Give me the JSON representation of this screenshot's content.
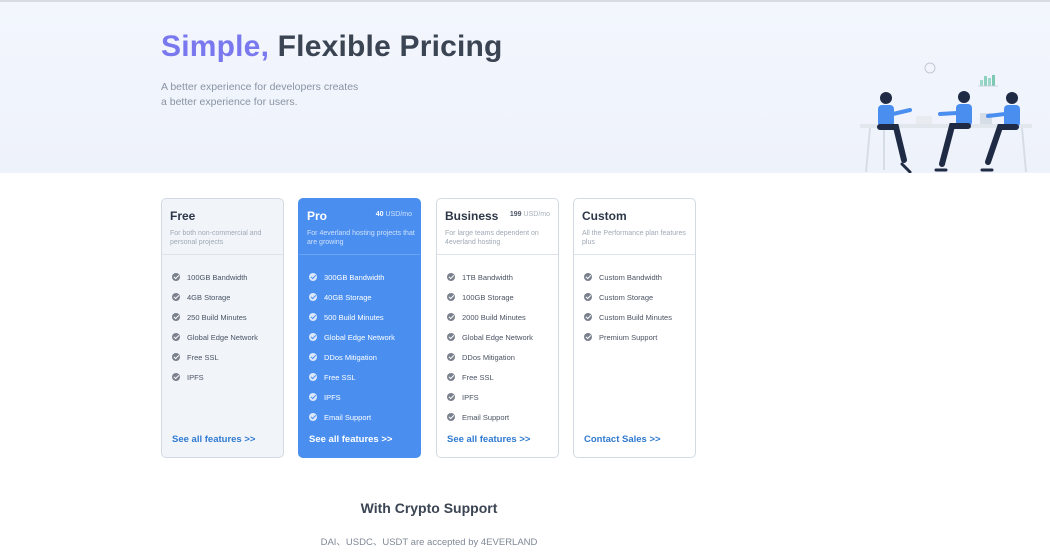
{
  "hero": {
    "title_accent": "Simple,",
    "title_rest": " Flexible Pricing",
    "subtitle_line1": "A better experience for developers creates",
    "subtitle_line2": "a better experience for users."
  },
  "plans": [
    {
      "name": "Free",
      "price": "",
      "price_unit": "",
      "description": "For both non-commercial and personal projects",
      "features": [
        "100GB Bandwidth",
        "4GB Storage",
        "250 Build Minutes",
        "Global Edge Network",
        "Free SSL",
        "IPFS"
      ],
      "link": "See all features >>"
    },
    {
      "name": "Pro",
      "price": "40",
      "price_unit": "USD/mo",
      "description": "For 4everland hosting projects that are growing",
      "features": [
        "300GB Bandwidth",
        "40GB Storage",
        "500 Build Minutes",
        "Global Edge Network",
        "DDos Mitigation",
        "Free SSL",
        "IPFS",
        "Email Support"
      ],
      "link": "See all features >>"
    },
    {
      "name": "Business",
      "price": "199",
      "price_unit": "USD/mo",
      "description": "For large teams dependent on 4everland hosting",
      "features": [
        "1TB Bandwidth",
        "100GB Storage",
        "2000 Build Minutes",
        "Global Edge Network",
        "DDos Mitigation",
        "Free SSL",
        "IPFS",
        "Email Support"
      ],
      "link": "See all features >>"
    },
    {
      "name": "Custom",
      "price": "",
      "price_unit": "",
      "description": "All the Performance plan features plus",
      "features": [
        "Custom Bandwidth",
        "Custom Storage",
        "Custom Build Minutes",
        "Premium Support"
      ],
      "link": "Contact Sales >>"
    }
  ],
  "crypto": {
    "title": "With Crypto Support",
    "subtitle": "DAI、USDC、USDT are accepted by 4EVERLAND"
  },
  "colors": {
    "accent_purple": "#7a78ee",
    "pro_blue": "#4a8ff0",
    "link_blue": "#2f7ad1",
    "hero_bg": "#f1f5fc"
  },
  "icons": {
    "feature": "check-circle-icon",
    "illustration": "team-meeting-illustration"
  }
}
